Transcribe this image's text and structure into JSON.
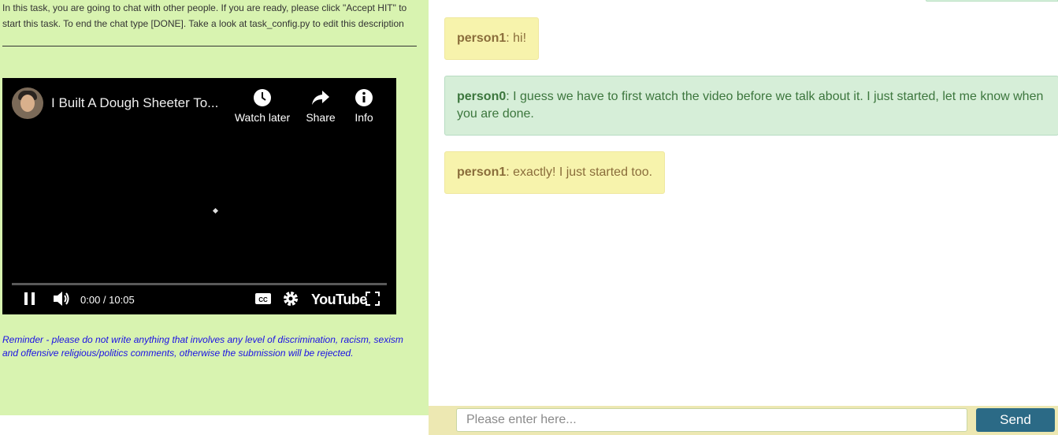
{
  "task": {
    "description": "In this task, you are going to chat with other people. If you are ready, please click \"Accept HIT\" to start this task. To end the chat type [DONE]. Take a look at task_config.py to edit this description",
    "reminder": "Reminder - please do not write anything that involves any level of discrimination, racism, sexism and offensive religious/politics comments, otherwise the submission will be rejected."
  },
  "video": {
    "title": "I Built A Dough Sheeter To...",
    "watch_later_label": "Watch later",
    "share_label": "Share",
    "info_label": "Info",
    "time": "0:00 / 10:05",
    "brand": "YouTube",
    "progress": 0
  },
  "chat": {
    "messages": [
      {
        "sender": "person1",
        "text": ": hi!"
      },
      {
        "sender": "person0",
        "text": ": I guess we have to first watch the video before we talk about it. I just started, let me know when you are done."
      },
      {
        "sender": "person1",
        "text": ": exactly! I just started too."
      }
    ]
  },
  "input": {
    "placeholder": "Please enter here...",
    "value": "",
    "send_label": "Send"
  },
  "colors": {
    "left_panel": "#d8f3b0",
    "person1_bubble": "#f7f3ac",
    "person0_bubble": "#d6eed8",
    "send_button": "#2b6a86",
    "reminder_text": "#1a10e6"
  }
}
